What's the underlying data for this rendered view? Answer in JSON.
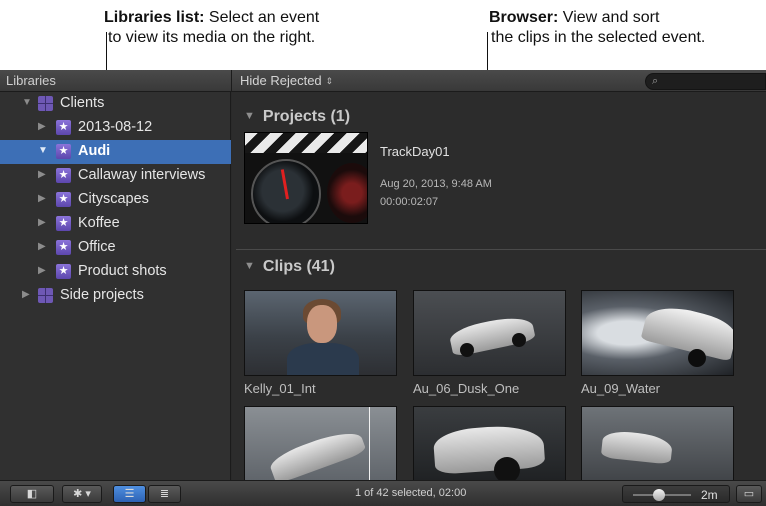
{
  "callouts": {
    "libraries": {
      "title": "Libraries list:",
      "line1": " Select an event",
      "line2": "to view its media on the right."
    },
    "browser": {
      "title": "Browser:",
      "line1": " View and sort",
      "line2": "the clips in the selected event."
    }
  },
  "header": {
    "libraries_label": "Libraries",
    "filter_label": "Hide Rejected",
    "filter_arrows": "⇕",
    "search_icon": "⌕"
  },
  "sidebar": {
    "items": [
      {
        "label": "Clients",
        "icon": "library-icon",
        "expanded": true
      },
      {
        "label": "2013-08-12",
        "icon": "event-star-icon"
      },
      {
        "label": "Audi",
        "icon": "event-star-icon",
        "selected": true
      },
      {
        "label": "Callaway interviews",
        "icon": "event-star-icon"
      },
      {
        "label": "Cityscapes",
        "icon": "event-star-icon"
      },
      {
        "label": "Koffee",
        "icon": "event-star-icon"
      },
      {
        "label": "Office",
        "icon": "event-star-icon"
      },
      {
        "label": "Product shots",
        "icon": "event-star-icon"
      },
      {
        "label": "Side projects",
        "icon": "library-icon"
      }
    ],
    "tri_collapsed": "▶",
    "tri_expanded": "▼",
    "star": "★"
  },
  "browser": {
    "projects_title": "Projects  (1)",
    "project": {
      "name": "TrackDay01",
      "date": "Aug 20, 2013, 9:48 AM",
      "duration": "00:00:02:07"
    },
    "clips_title": "Clips  (41)",
    "clips": [
      {
        "name": "Kelly_01_Int"
      },
      {
        "name": "Au_06_Dusk_One"
      },
      {
        "name": "Au_09_Water"
      },
      {
        "name": ""
      },
      {
        "name": ""
      },
      {
        "name": ""
      }
    ]
  },
  "toolbar": {
    "library_toggle_icon": "◧",
    "action_icon": "✱ ▾",
    "filmstrip_icon": "☰",
    "list_icon": "≣",
    "status": "1 of 42 selected, 02:00",
    "zoom_value": "2m",
    "appearance_icon": "▭"
  },
  "colors": {
    "selection": "#3d6fb6",
    "event_icon": "#7a62c8",
    "background": "#2c2c2c"
  }
}
